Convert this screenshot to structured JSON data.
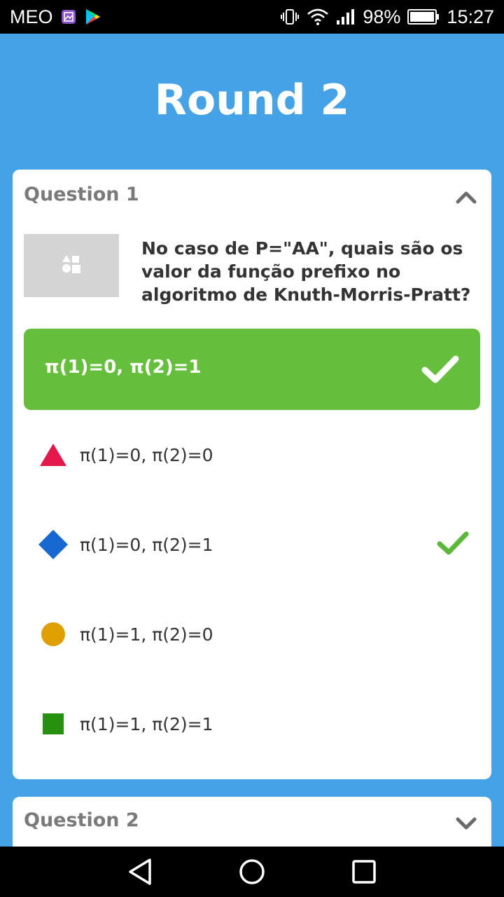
{
  "status_bar": {
    "carrier": "MEO",
    "battery": "98%",
    "time": "15:27"
  },
  "round": {
    "title": "Round 2"
  },
  "question1": {
    "header": "Question 1",
    "image_icon": "shapes-icon",
    "text": "No caso de P=\"AA\", quais são os valor da função prefixo no algoritmo de Knuth-Morris-Pratt?",
    "correct_answer": "π(1)=0, π(2)=1",
    "options": [
      {
        "shape": "triangle",
        "color": "#e5184b",
        "label": "π(1)=0, π(2)=0",
        "is_correct": false
      },
      {
        "shape": "diamond",
        "color": "#1768d1",
        "label": "π(1)=0, π(2)=1",
        "is_correct": true
      },
      {
        "shape": "circle",
        "color": "#df9f00",
        "label": "π(1)=1, π(2)=0",
        "is_correct": false
      },
      {
        "shape": "square",
        "color": "#25910f",
        "label": "π(1)=1, π(2)=1",
        "is_correct": false
      }
    ]
  },
  "question2": {
    "header": "Question 2"
  },
  "colors": {
    "background": "#46a2e6",
    "correct_green": "#66bf3c",
    "check_green": "#5cb83a"
  }
}
